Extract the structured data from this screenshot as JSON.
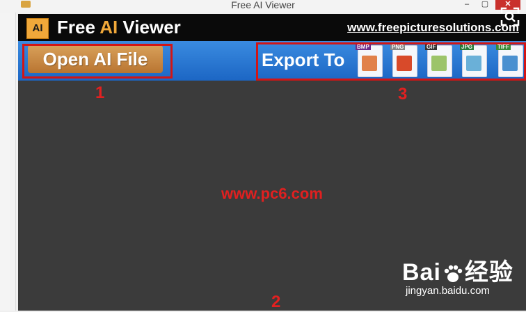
{
  "window": {
    "title": "Free AI Viewer",
    "controls": {
      "minimize": "–",
      "maximize": "▢",
      "close": "✕"
    }
  },
  "header": {
    "logo_text": "AI",
    "title_prefix": "Free ",
    "title_highlight": "AI",
    "title_suffix": " Viewer",
    "site_link": "www.freepicturesolutions.com"
  },
  "toolbar": {
    "open_label": "Open AI File",
    "export_label": "Export To",
    "formats": [
      {
        "tag": "BMP",
        "tag_color": "#6b2c8a",
        "pic_color": "#e1814a"
      },
      {
        "tag": "PNG",
        "tag_color": "#cccccc",
        "pic_color": "#d84a2a"
      },
      {
        "tag": "GIF",
        "tag_color": "#333333",
        "pic_color": "#9cc46a"
      },
      {
        "tag": "JPG",
        "tag_color": "#2a7a3a",
        "pic_color": "#6ab0d8"
      },
      {
        "tag": "TIFF",
        "tag_color": "#3a8a3a",
        "pic_color": "#4a90d0"
      }
    ]
  },
  "annotations": {
    "n1": "1",
    "n2": "2",
    "n3": "3"
  },
  "main": {
    "watermark": "www.pc6.com"
  },
  "overlay": {
    "baidu_text_left": "Bai",
    "baidu_text_right": "经验",
    "baidu_url": "jingyan.baidu.com"
  },
  "colors": {
    "accent": "#f0a83a",
    "toolbar": "#2a78d6",
    "callout": "#d21515"
  }
}
